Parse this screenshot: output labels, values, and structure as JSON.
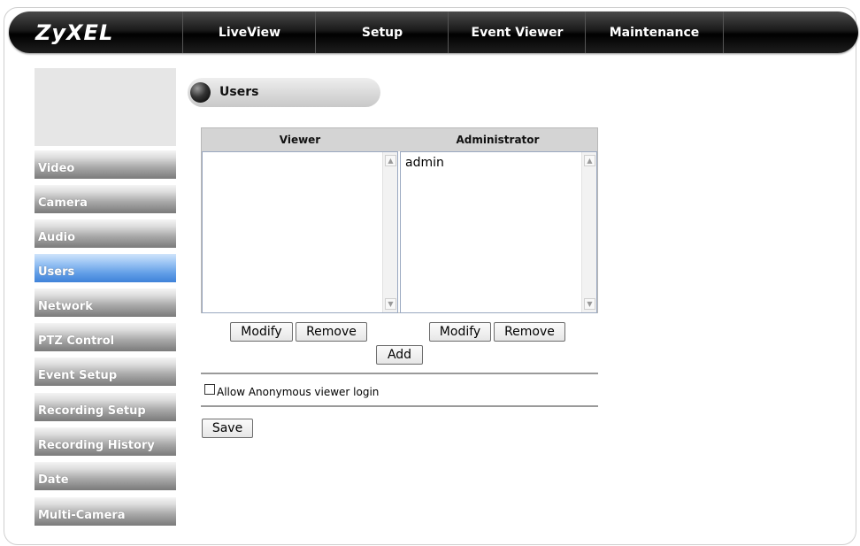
{
  "brand": "ZyXEL",
  "topnav": [
    "LiveView",
    "Setup",
    "Event Viewer",
    "Maintenance"
  ],
  "sidebar": {
    "items": [
      {
        "label": "Video",
        "active": false
      },
      {
        "label": "Camera",
        "active": false
      },
      {
        "label": "Audio",
        "active": false
      },
      {
        "label": "Users",
        "active": true
      },
      {
        "label": "Network",
        "active": false
      },
      {
        "label": "PTZ Control",
        "active": false
      },
      {
        "label": "Event Setup",
        "active": false
      },
      {
        "label": "Recording Setup",
        "active": false
      },
      {
        "label": "Recording History",
        "active": false
      },
      {
        "label": "Date",
        "active": false
      },
      {
        "label": "Multi-Camera",
        "active": false
      }
    ]
  },
  "section_title": "Users",
  "users": {
    "viewer_header": "Viewer",
    "admin_header": "Administrator",
    "viewers": [],
    "administrators": [
      "admin"
    ],
    "modify_label": "Modify",
    "remove_label": "Remove",
    "add_label": "Add",
    "anonymous_label": "Allow Anonymous viewer login",
    "anonymous_checked": false,
    "save_label": "Save"
  },
  "colors": {
    "active_sidebar": "#5f9ce6",
    "topbar": "#111111"
  }
}
